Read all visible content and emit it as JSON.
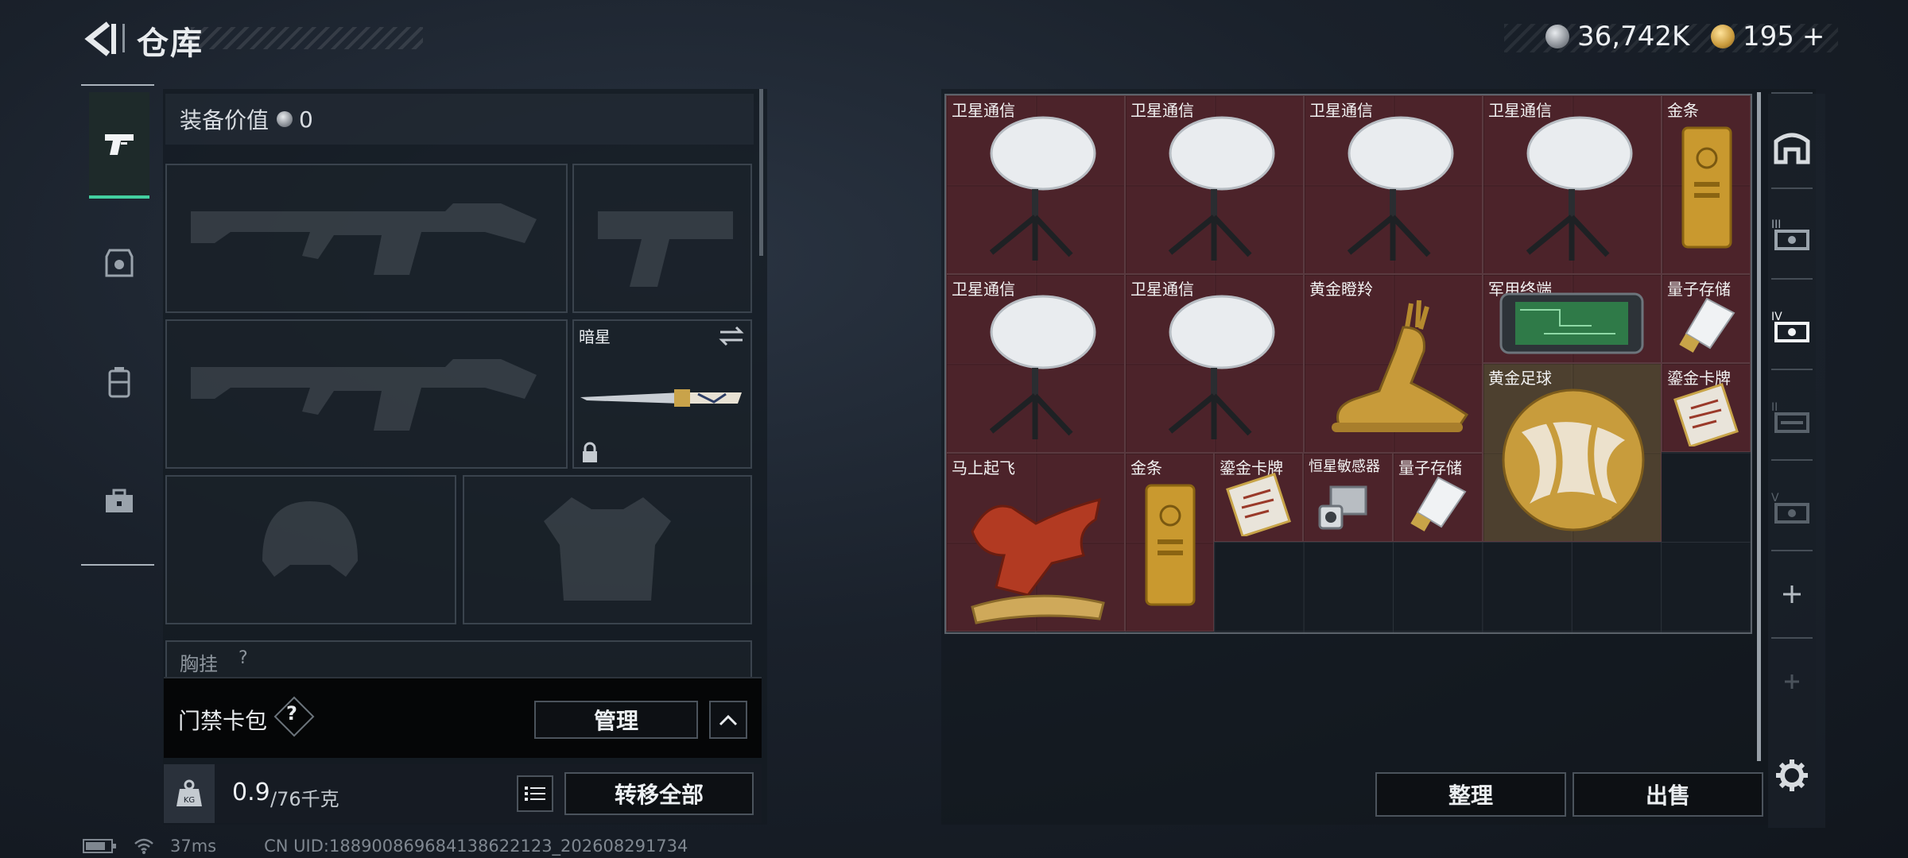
{
  "header": {
    "title": "仓库",
    "currency_primary": "36,742K",
    "currency_secondary": "195",
    "currency_secondary_plus": "+"
  },
  "left_nav": {
    "items": [
      {
        "name": "weapons",
        "icon": "pistol-icon",
        "active": true
      },
      {
        "name": "armor",
        "icon": "armor-icon",
        "active": false
      },
      {
        "name": "backpack",
        "icon": "backpack-icon",
        "active": false
      },
      {
        "name": "toolbox",
        "icon": "toolbox-icon",
        "active": false
      }
    ]
  },
  "equipment": {
    "value_label": "装备价值",
    "value": "0",
    "melee_name": "暗星",
    "chest_rig_label": "胸挂",
    "chest_rig_help": "?"
  },
  "access_card": {
    "label": "门禁卡包",
    "help": "?",
    "manage_button": "管理"
  },
  "weight": {
    "current": "0.9",
    "max": "/76千克",
    "transfer_all_button": "转移全部"
  },
  "stash": {
    "items": [
      {
        "label": "卫星通信",
        "icon": "satellite-dish-icon"
      },
      {
        "label": "卫星通信",
        "icon": "satellite-dish-icon"
      },
      {
        "label": "卫星通信",
        "icon": "satellite-dish-icon"
      },
      {
        "label": "卫星通信",
        "icon": "satellite-dish-icon"
      },
      {
        "label": "金条",
        "icon": "gold-bar-icon"
      },
      {
        "label": "卫星通信",
        "icon": "satellite-dish-icon"
      },
      {
        "label": "卫星通信",
        "icon": "satellite-dish-icon"
      },
      {
        "label": "黄金瞪羚",
        "icon": "gold-gazelle-icon"
      },
      {
        "label": "军用终端",
        "icon": "military-terminal-icon"
      },
      {
        "label": "量子存储",
        "icon": "quantum-storage-icon"
      },
      {
        "label": "黄金足球",
        "icon": "gold-football-icon"
      },
      {
        "label": "鎏金卡牌",
        "icon": "gilded-card-icon"
      },
      {
        "label": "马上起飞",
        "icon": "red-horse-icon"
      },
      {
        "label": "金条",
        "icon": "gold-bar-icon"
      },
      {
        "label": "鎏金卡牌",
        "icon": "gilded-card-icon"
      },
      {
        "label": "恒星敏感器",
        "icon": "star-sensor-icon"
      },
      {
        "label": "量子存储",
        "icon": "quantum-storage-icon"
      }
    ],
    "sort_button": "整理",
    "sell_button": "出售"
  },
  "right_nav": {
    "icons": [
      "safe-box-icon",
      "stash-tab-3-icon",
      "stash-tab-4-icon",
      "stash-tab-2-icon",
      "stash-tab-5-icon",
      "add-icon",
      "add-icon-disabled",
      "settings-gear-icon"
    ]
  },
  "status_bar": {
    "ping": "37ms",
    "uid": "CN UID:188900869684138622123_202608291734"
  },
  "colors": {
    "active_accent": "#43d0a0",
    "item_cell_red": "#58242c",
    "panel_bg": "#141a21"
  }
}
